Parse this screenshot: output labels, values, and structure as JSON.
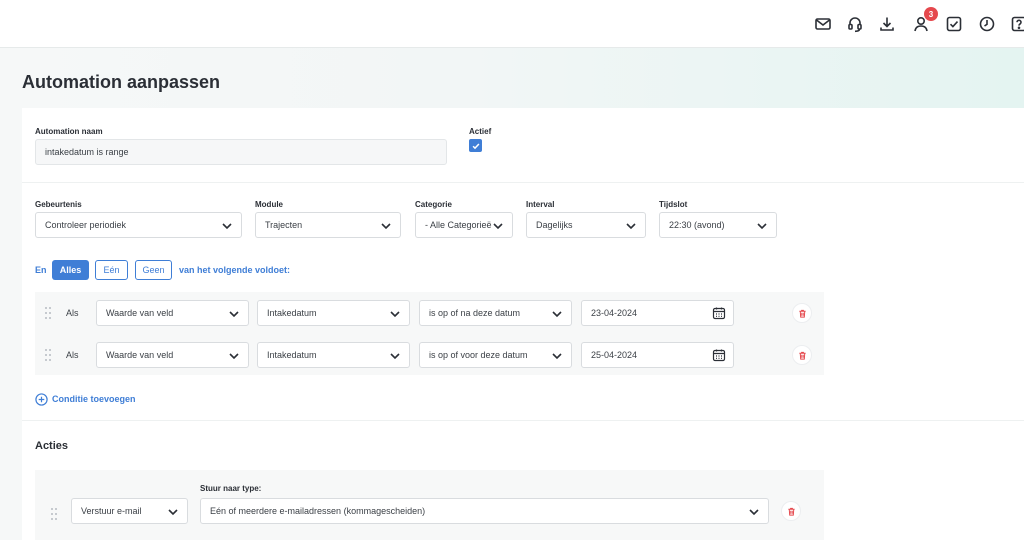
{
  "header": {
    "icons": [
      "mail-icon",
      "headset-icon",
      "download-icon",
      "user-icon",
      "tasks-icon",
      "clock-icon",
      "help-icon"
    ],
    "notification_count": "3"
  },
  "page": {
    "title": "Automation aanpassen"
  },
  "form": {
    "name_label": "Automation naam",
    "name_value": "intakedatum is range",
    "active_label": "Actief",
    "active_checked": true,
    "event_label": "Gebeurtenis",
    "event_value": "Controleer periodiek",
    "module_label": "Module",
    "module_value": "Trajecten",
    "category_label": "Categorie",
    "category_value": "- Alle Categorieën",
    "interval_label": "Interval",
    "interval_value": "Dagelijks",
    "timeslot_label": "Tijdslot",
    "timeslot_value": "22:30 (avond)"
  },
  "match": {
    "prefix": "En",
    "options": [
      "Alles",
      "Eén",
      "Geen"
    ],
    "selected": "Alles",
    "suffix": "van het volgende voldoet:"
  },
  "conditions": [
    {
      "als": "Als",
      "type": "Waarde van veld",
      "field": "Intakedatum",
      "operator": "is op of na deze datum",
      "date": "23-04-2024"
    },
    {
      "als": "Als",
      "type": "Waarde van veld",
      "field": "Intakedatum",
      "operator": "is op of voor deze datum",
      "date": "25-04-2024"
    }
  ],
  "add_condition_label": "Conditie toevoegen",
  "actions": {
    "title": "Acties",
    "send_to_label": "Stuur naar type:",
    "action_value": "Verstuur e-mail",
    "send_to_value": "Eén of meerdere e-mailadressen (kommagescheiden)"
  },
  "colors": {
    "accent": "#3f7ed6",
    "badge": "#e5484d",
    "delete": "#e5484d"
  }
}
